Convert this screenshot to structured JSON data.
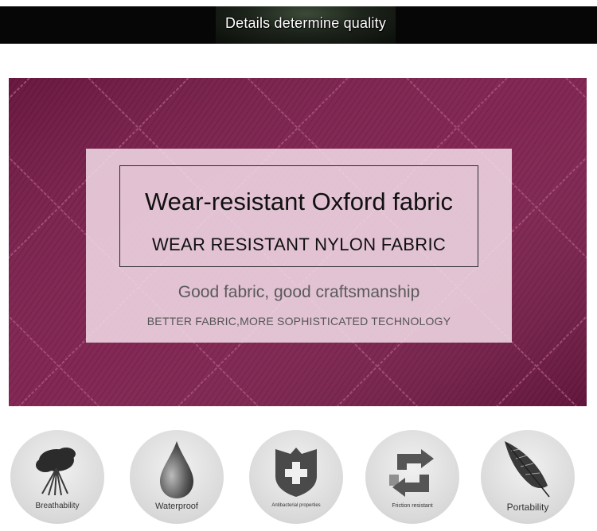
{
  "banner": {
    "title": "Details determine quality"
  },
  "panel": {
    "headline": "Wear-resistant Oxford fabric",
    "subheadline": "WEAR RESISTANT NYLON FABRIC",
    "tagline": "Good fabric, good craftsmanship",
    "caption": "BETTER FABRIC,MORE SOPHISTICATED TECHNOLOGY"
  },
  "features": [
    {
      "label": "Breathability",
      "icon": "feather-tuft-icon"
    },
    {
      "label": "Waterproof",
      "icon": "water-drop-icon"
    },
    {
      "label": "Antibacterial properties",
      "icon": "shield-cross-icon"
    },
    {
      "label": "Friction resistant",
      "icon": "recycle-arrows-icon"
    },
    {
      "label": "Portability",
      "icon": "feather-icon"
    }
  ],
  "colors": {
    "fabric": "#7a1c4a",
    "panel": "#f2dce8",
    "banner": "#060606"
  }
}
